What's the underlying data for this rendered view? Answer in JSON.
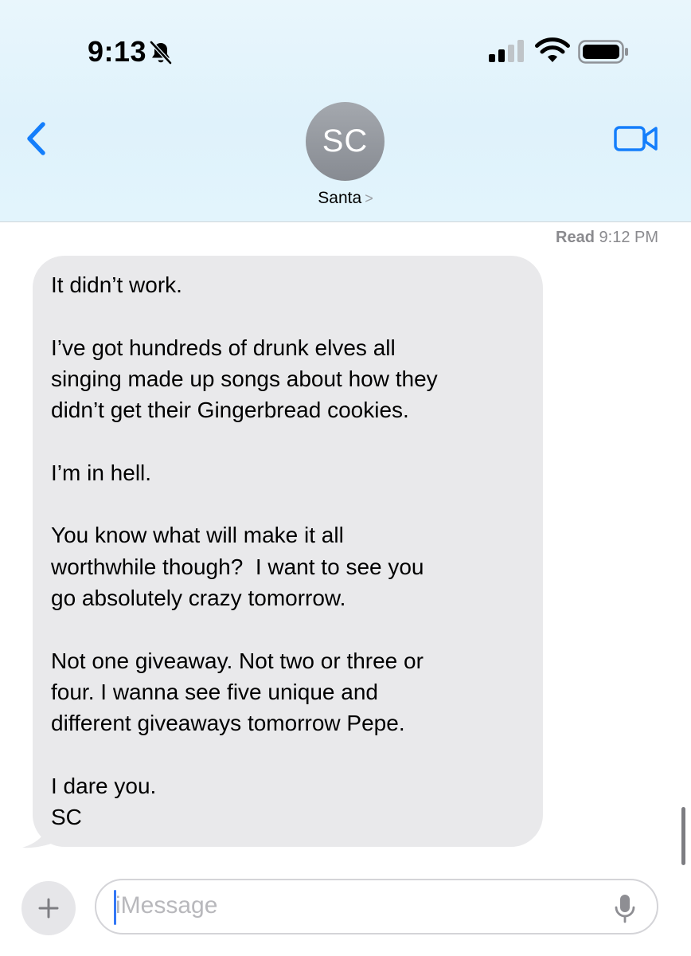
{
  "status_bar": {
    "time": "9:13",
    "silent_icon": "bell-slash-icon",
    "signal_icon": "cellular-signal-icon",
    "wifi_icon": "wifi-icon",
    "battery_icon": "battery-icon"
  },
  "header": {
    "back_icon": "chevron-left-icon",
    "avatar_initials": "SC",
    "contact_name": "Santa",
    "contact_chevron": ">",
    "video_icon": "video-camera-icon",
    "accent_color": "#147efb"
  },
  "conversation": {
    "read_label": "Read",
    "read_time": "9:12 PM",
    "messages": [
      {
        "direction": "incoming",
        "text": "It didn’t work.\n\nI’ve got hundreds of drunk elves all\nsinging made up songs about how they\ndidn’t get their Gingerbread cookies.\n\nI’m in hell.\n\nYou know what will make it all\nworthwhile though?  I want to see you\ngo absolutely crazy tomorrow.\n\nNot one giveaway. Not two or three or\nfour. I wanna see five unique and\ndifferent giveaways tomorrow Pepe.\n\nI dare you.\nSC"
      }
    ]
  },
  "composer": {
    "plus_label": "+",
    "placeholder": "iMessage",
    "mic_icon": "microphone-icon"
  }
}
